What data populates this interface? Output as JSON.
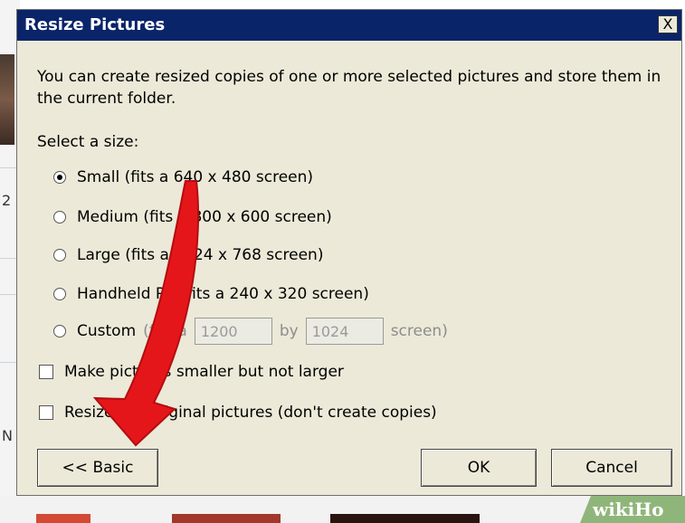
{
  "dialog": {
    "title": "Resize Pictures",
    "close_glyph": "X",
    "description": "You can create resized copies of one or more selected pictures and store them in the current folder.",
    "select_label": "Select a size:"
  },
  "sizes": [
    {
      "label": "Small (fits a 640 x 480 screen)",
      "selected": true
    },
    {
      "label": "Medium (fits a 800 x 600 screen)",
      "selected": false
    },
    {
      "label": "Large (fits a 1024 x 768 screen)",
      "selected": false
    },
    {
      "label": "Handheld PC (fits a 240 x 320 screen)",
      "selected": false
    }
  ],
  "custom": {
    "label": "Custom",
    "prefix": "(fits a",
    "width_value": "1200",
    "by": "by",
    "height_value": "1024",
    "suffix": "screen)"
  },
  "options": {
    "smaller_only": "Make pictures smaller but not larger",
    "resize_originals": "Resize the original pictures (don't create copies)"
  },
  "buttons": {
    "basic": "<< Basic",
    "ok": "OK",
    "cancel": "Cancel"
  },
  "background": {
    "char_top": "2",
    "char_bottom": "N",
    "watermark": "wikiHo"
  },
  "colors": {
    "titlebar": "#0a246a",
    "dialog_bg": "#ece9d8",
    "arrow": "#e5161a"
  }
}
